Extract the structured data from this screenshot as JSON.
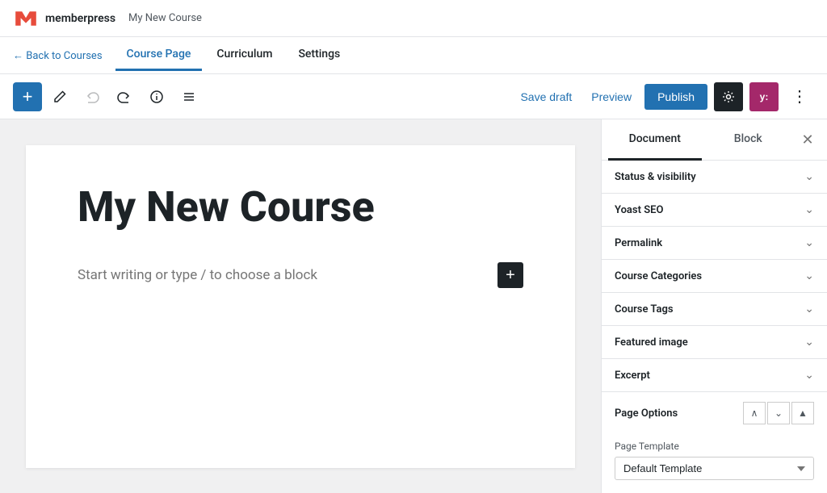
{
  "adminBar": {
    "brandName": "memberpress",
    "pageTitle": "My New Course"
  },
  "subNav": {
    "backLink": "← Back to Courses",
    "tabs": [
      {
        "id": "course-page",
        "label": "Course Page",
        "active": true
      },
      {
        "id": "curriculum",
        "label": "Curriculum",
        "active": false
      },
      {
        "id": "settings",
        "label": "Settings",
        "active": false
      }
    ]
  },
  "toolbar": {
    "saveDraftLabel": "Save draft",
    "previewLabel": "Preview",
    "publishLabel": "Publish",
    "gearLabel": "⚙",
    "yoastLabel": "y:",
    "moreLabel": "⋮"
  },
  "editor": {
    "courseTitle": "My New Course",
    "placeholderText": "Start writing or type / to choose a block"
  },
  "sidebar": {
    "tabs": [
      {
        "id": "document",
        "label": "Document",
        "active": true
      },
      {
        "id": "block",
        "label": "Block",
        "active": false
      }
    ],
    "sections": [
      {
        "id": "status-visibility",
        "label": "Status & visibility"
      },
      {
        "id": "yoast-seo",
        "label": "Yoast SEO"
      },
      {
        "id": "permalink",
        "label": "Permalink"
      },
      {
        "id": "course-categories",
        "label": "Course Categories"
      },
      {
        "id": "course-tags",
        "label": "Course Tags"
      },
      {
        "id": "featured-image",
        "label": "Featured image"
      },
      {
        "id": "excerpt",
        "label": "Excerpt"
      }
    ],
    "pageOptions": {
      "title": "Page Options",
      "templateLabel": "Page Template",
      "templateOptions": [
        {
          "value": "default",
          "label": "Default Template"
        }
      ],
      "templateSelected": "Default Template"
    }
  }
}
